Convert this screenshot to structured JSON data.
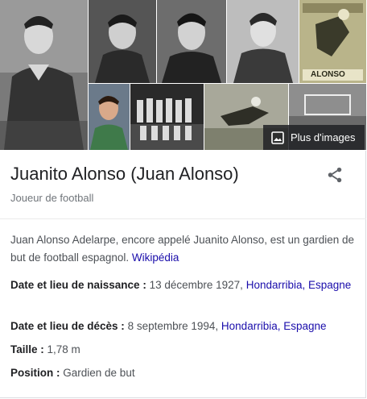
{
  "images": {
    "more_label": "Plus d'images",
    "tiles": [
      {
        "name": "player-portrait-large",
        "desc": "player-photo"
      },
      {
        "name": "player-portrait-2",
        "desc": "player-photo"
      },
      {
        "name": "player-portrait-3",
        "desc": "player-photo"
      },
      {
        "name": "player-portrait-4",
        "desc": "player-photo"
      },
      {
        "name": "magazine-cover",
        "desc": "magazine"
      },
      {
        "name": "player-portrait-color",
        "desc": "player-photo"
      },
      {
        "name": "team-photo",
        "desc": "team"
      },
      {
        "name": "goalkeeper-dive",
        "desc": "action"
      },
      {
        "name": "stadium-action",
        "desc": "action"
      }
    ],
    "magazine_text": "ALONSO"
  },
  "header": {
    "title": "Juanito Alonso (Juan Alonso)",
    "subtitle": "Joueur de football"
  },
  "description": {
    "text": "Juan Alonso Adelarpe, encore appelé Juanito Alonso, est un gardien de but de football espagnol.",
    "source": "Wikipédia"
  },
  "facts": {
    "birth": {
      "label": "Date et lieu de naissance :",
      "date": "13 décembre 1927,",
      "place1": "Hondarribia,",
      "place2": "Espagne"
    },
    "death": {
      "label": "Date et lieu de décès :",
      "date": "8 septembre 1994,",
      "place1": "Hondarribia,",
      "place2": "Espagne"
    },
    "height": {
      "label": "Taille :",
      "value": "1,78 m"
    },
    "position": {
      "label": "Position :",
      "value": "Gardien de but"
    }
  },
  "colors": {
    "link": "#1a0dab",
    "text": "#202124",
    "muted": "#70757a"
  }
}
